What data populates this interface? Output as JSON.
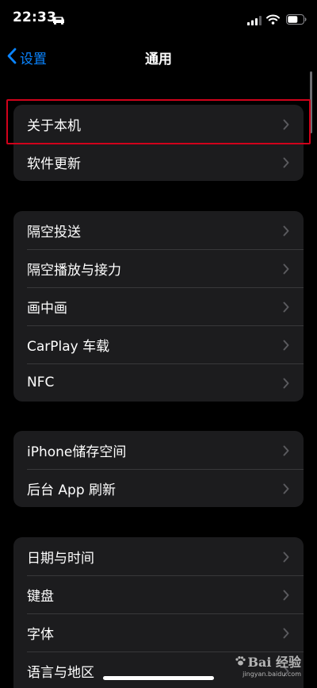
{
  "status_bar": {
    "time": "22:33",
    "icons": [
      "car-icon",
      "signal-icon",
      "wifi-icon",
      "battery-icon"
    ]
  },
  "nav": {
    "back_label": "设置",
    "title": "通用"
  },
  "groups": [
    {
      "items": [
        {
          "label": "关于本机"
        },
        {
          "label": "软件更新"
        }
      ]
    },
    {
      "items": [
        {
          "label": "隔空投送"
        },
        {
          "label": "隔空播放与接力"
        },
        {
          "label": "画中画"
        },
        {
          "label": "CarPlay 车载"
        },
        {
          "label": "NFC"
        }
      ]
    },
    {
      "items": [
        {
          "label": "iPhone储存空间"
        },
        {
          "label": "后台 App 刷新"
        }
      ]
    },
    {
      "items": [
        {
          "label": "日期与时间"
        },
        {
          "label": "键盘"
        },
        {
          "label": "字体"
        },
        {
          "label": "语言与地区"
        }
      ]
    }
  ],
  "highlighted_item": "关于本机",
  "watermark": {
    "logo": "Bai 经验",
    "url": "jingyan.baidu.com"
  },
  "colors": {
    "background": "#000000",
    "group_background": "#1c1c1e",
    "separator": "#38383a",
    "accent": "#0a84ff",
    "chevron": "#5a5a5e",
    "highlight": "#d0021b"
  }
}
